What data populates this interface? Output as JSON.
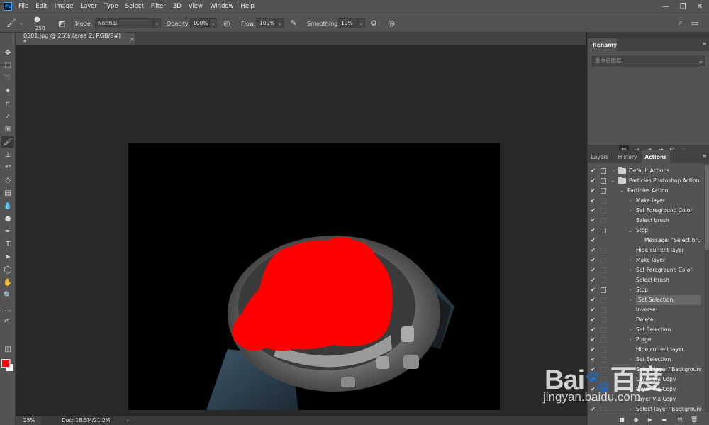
{
  "app": {
    "logo_text": "Ps"
  },
  "menu": [
    "File",
    "Edit",
    "Image",
    "Layer",
    "Type",
    "Select",
    "Filter",
    "3D",
    "View",
    "Window",
    "Help"
  ],
  "options": {
    "brush_size": "250",
    "mode_label": "Mode:",
    "mode_value": "Normal",
    "opacity_label": "Opacity:",
    "opacity_value": "100%",
    "flow_label": "Flow:",
    "flow_value": "100%",
    "smoothing_label": "Smoothing:",
    "smoothing_value": "10%"
  },
  "document": {
    "tab_title": "0501.jpg @ 25% (area 2, RGB/8#) *",
    "close_glyph": "×",
    "zoom": "25%",
    "doc_info": "Doc: 18.5M/21.2M",
    "status_arrow": "›"
  },
  "colors": {
    "foreground": "#ff0000",
    "background": "#ffffff",
    "accent": "#31a8ff"
  },
  "renamy": {
    "title": "Renamy",
    "search_placeholder": "重命名图层"
  },
  "panel_tabs": [
    "Layers",
    "History",
    "Actions"
  ],
  "actions": [
    {
      "label": "Default Actions",
      "indent": 0,
      "arrow": "›",
      "folder": true,
      "dialog": true
    },
    {
      "label": "Particles Photoshop Action",
      "indent": 0,
      "arrow": "⌄",
      "folder": true,
      "dialog": true
    },
    {
      "label": "Particles Action",
      "indent": 1,
      "arrow": "⌄",
      "folder": false,
      "dialog": true
    },
    {
      "label": "Make layer",
      "indent": 2,
      "arrow": "›",
      "folder": false,
      "dialog": false
    },
    {
      "label": "Set Foreground Color",
      "indent": 2,
      "arrow": "›",
      "folder": false,
      "dialog": false
    },
    {
      "label": "Select brush",
      "indent": 2,
      "arrow": "",
      "folder": false,
      "dialog": false
    },
    {
      "label": "Stop",
      "indent": 2,
      "arrow": "⌄",
      "folder": false,
      "dialog": true
    },
    {
      "label": "Message: \"Select brush...",
      "indent": 3,
      "arrow": "",
      "folder": false,
      "dialog": null
    },
    {
      "label": "Hide current layer",
      "indent": 2,
      "arrow": "",
      "folder": false,
      "dialog": false
    },
    {
      "label": "Make layer",
      "indent": 2,
      "arrow": "›",
      "folder": false,
      "dialog": false
    },
    {
      "label": "Set Foreground Color",
      "indent": 2,
      "arrow": "›",
      "folder": false,
      "dialog": false
    },
    {
      "label": "Select brush",
      "indent": 2,
      "arrow": "",
      "folder": false,
      "dialog": false
    },
    {
      "label": "Stop",
      "indent": 2,
      "arrow": "›",
      "folder": false,
      "dialog": true
    },
    {
      "label": "Set Selection",
      "indent": 2,
      "arrow": "›",
      "folder": false,
      "dialog": false,
      "selected": true
    },
    {
      "label": "Inverse",
      "indent": 2,
      "arrow": "",
      "folder": false,
      "dialog": false
    },
    {
      "label": "Delete",
      "indent": 2,
      "arrow": "",
      "folder": false,
      "dialog": false
    },
    {
      "label": "Set Selection",
      "indent": 2,
      "arrow": "›",
      "folder": false,
      "dialog": false
    },
    {
      "label": "Purge",
      "indent": 2,
      "arrow": "›",
      "folder": false,
      "dialog": false
    },
    {
      "label": "Hide current layer",
      "indent": 2,
      "arrow": "",
      "folder": false,
      "dialog": false
    },
    {
      "label": "Set Selection",
      "indent": 2,
      "arrow": "›",
      "folder": false,
      "dialog": false
    },
    {
      "label": "Select layer \"Background\"",
      "indent": 2,
      "arrow": "›",
      "folder": false,
      "dialog": false
    },
    {
      "label": "Layer Via Copy",
      "indent": 2,
      "arrow": "",
      "folder": false,
      "dialog": false
    },
    {
      "label": "Layer Via Copy",
      "indent": 2,
      "arrow": "",
      "folder": false,
      "dialog": false
    },
    {
      "label": "Layer Via Copy",
      "indent": 2,
      "arrow": "",
      "folder": false,
      "dialog": false
    },
    {
      "label": "Select layer \"Background\"",
      "indent": 2,
      "arrow": "›",
      "folder": false,
      "dialog": false
    }
  ],
  "watermark": {
    "logo": "Bai du 百度",
    "url": "jingyan.baidu.com"
  }
}
